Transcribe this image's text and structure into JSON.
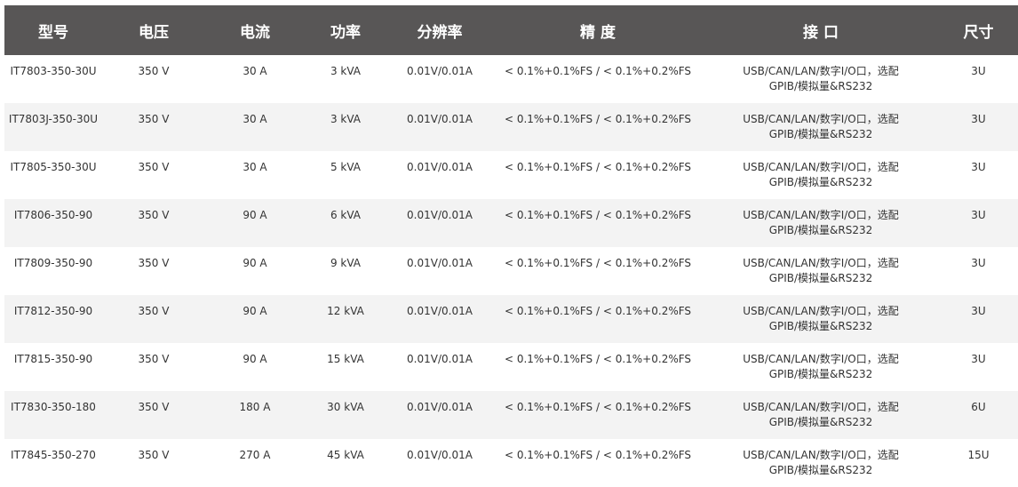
{
  "table": {
    "headers": [
      "型号",
      "电压",
      "电流",
      "功率",
      "分辨率",
      "精 度",
      "接 口",
      "尺寸"
    ],
    "rows": [
      [
        "IT7803-350-30U",
        "350 V",
        "30 A",
        "3 kVA",
        "0.01V/0.01A",
        "< 0.1%+0.1%FS / < 0.1%+0.2%FS",
        "USB/CAN/LAN/数字I/O口，选配GPIB/模拟量&RS232",
        "3U"
      ],
      [
        "IT7803J-350-30U",
        "350 V",
        "30 A",
        "3 kVA",
        "0.01V/0.01A",
        "< 0.1%+0.1%FS / < 0.1%+0.2%FS",
        "USB/CAN/LAN/数字I/O口，选配GPIB/模拟量&RS232",
        "3U"
      ],
      [
        "IT7805-350-30U",
        "350 V",
        "30 A",
        "5 kVA",
        "0.01V/0.01A",
        "< 0.1%+0.1%FS / < 0.1%+0.2%FS",
        "USB/CAN/LAN/数字I/O口，选配GPIB/模拟量&RS232",
        "3U"
      ],
      [
        "IT7806-350-90",
        "350 V",
        "90 A",
        "6 kVA",
        "0.01V/0.01A",
        "< 0.1%+0.1%FS / < 0.1%+0.2%FS",
        "USB/CAN/LAN/数字I/O口，选配GPIB/模拟量&RS232",
        "3U"
      ],
      [
        "IT7809-350-90",
        "350 V",
        "90 A",
        "9 kVA",
        "0.01V/0.01A",
        "< 0.1%+0.1%FS / < 0.1%+0.2%FS",
        "USB/CAN/LAN/数字I/O口，选配GPIB/模拟量&RS232",
        "3U"
      ],
      [
        "IT7812-350-90",
        "350 V",
        "90 A",
        "12 kVA",
        "0.01V/0.01A",
        "< 0.1%+0.1%FS / < 0.1%+0.2%FS",
        "USB/CAN/LAN/数字I/O口，选配GPIB/模拟量&RS232",
        "3U"
      ],
      [
        "IT7815-350-90",
        "350 V",
        "90 A",
        "15 kVA",
        "0.01V/0.01A",
        "< 0.1%+0.1%FS / < 0.1%+0.2%FS",
        "USB/CAN/LAN/数字I/O口，选配GPIB/模拟量&RS232",
        "3U"
      ],
      [
        "IT7830-350-180",
        "350 V",
        "180 A",
        "30 kVA",
        "0.01V/0.01A",
        "< 0.1%+0.1%FS / < 0.1%+0.2%FS",
        "USB/CAN/LAN/数字I/O口，选配GPIB/模拟量&RS232",
        "6U"
      ],
      [
        "IT7845-350-270",
        "350 V",
        "270 A",
        "45 kVA",
        "0.01V/0.01A",
        "< 0.1%+0.1%FS / < 0.1%+0.2%FS",
        "USB/CAN/LAN/数字I/O口，选配GPIB/模拟量&RS232",
        "15U"
      ]
    ]
  },
  "colors": {
    "header_bg": "#585656",
    "header_text": "#ffffff",
    "row_alt_bg": "#f3f3f3",
    "cell_text": "#333333"
  }
}
